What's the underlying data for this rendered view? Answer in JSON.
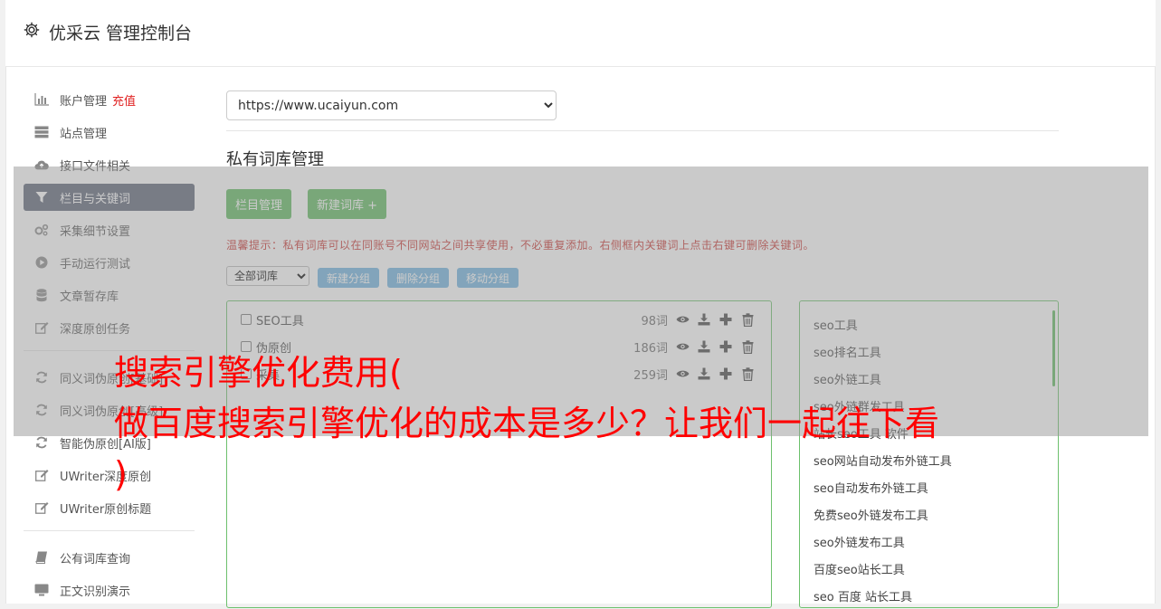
{
  "header": {
    "title": "优采云 管理控制台",
    "icon": "gear-icon"
  },
  "sidebar": {
    "items": [
      {
        "label": "账户管理",
        "badge": "充值",
        "icon": "bar-chart-icon"
      },
      {
        "label": "站点管理",
        "icon": "server-icon"
      },
      {
        "label": "接口文件相关",
        "icon": "cloud-upload-icon"
      },
      {
        "label": "栏目与关键词",
        "icon": "filter-icon",
        "active": true
      },
      {
        "label": "采集细节设置",
        "icon": "gears-icon"
      },
      {
        "label": "手动运行测试",
        "icon": "play-icon"
      },
      {
        "label": "文章暂存库",
        "icon": "database-icon"
      },
      {
        "label": "深度原创任务",
        "icon": "edit-icon"
      }
    ],
    "items2": [
      {
        "label": "同义词伪原创[基础]",
        "icon": "refresh-icon"
      },
      {
        "label": "同义词伪原创[高级]",
        "icon": "refresh-icon"
      },
      {
        "label": "智能伪原创[AI版]",
        "icon": "refresh-icon"
      },
      {
        "label": "UWriter深度原创",
        "icon": "edit-icon"
      },
      {
        "label": "UWriter原创标题",
        "icon": "edit-icon"
      }
    ],
    "items3": [
      {
        "label": "公有词库查询",
        "icon": "book-icon"
      },
      {
        "label": "正文识别演示",
        "icon": "monitor-icon"
      }
    ]
  },
  "main": {
    "site_select": "https://www.ucaiyun.com",
    "title": "私有词库管理",
    "btn_columns": "栏目管理",
    "btn_new_lib": "新建词库 +",
    "hint": "温馨提示：私有词库可以在同账号不同网站之间共享使用，不必重复添加。右侧框内关键词上点击右键可删除关键词。",
    "filter_select": "全部词库",
    "btn_new_group": "新建分组",
    "btn_delete_group": "删除分组",
    "btn_move_group": "移动分组",
    "libraries": [
      {
        "name": "SEO工具",
        "count": "98词"
      },
      {
        "name": "伪原创",
        "count": "186词"
      },
      {
        "name": "采集",
        "count": "259词"
      }
    ],
    "keywords": [
      "seo工具",
      "seo排名工具",
      "seo外链工具",
      "seo外链群发工具",
      "站长seo工具 软件",
      "seo网站自动发布外链工具",
      "seo自动发布外链工具",
      "免费seo外链发布工具",
      "seo外链发布工具",
      "百度seo站长工具",
      "seo 百度 站长工具"
    ]
  },
  "overlay": {
    "line1": "搜索引擎优化费用(",
    "line2": "做百度搜索引擎优化的成本是多少？让我们一起往下看",
    "line3": ")"
  }
}
